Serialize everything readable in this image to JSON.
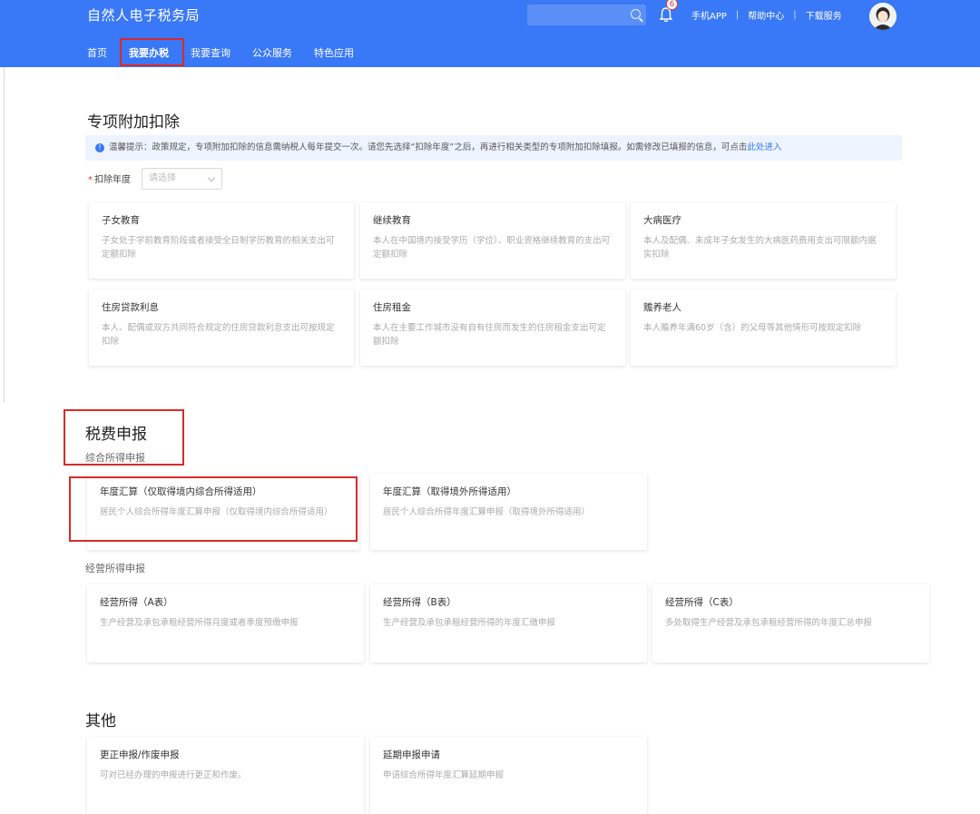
{
  "header": {
    "app_title": "自然人电子税务局",
    "badge_count": "6",
    "links": [
      "手机APP",
      "帮助中心",
      "下载服务"
    ],
    "nav": [
      "首页",
      "我要办税",
      "我要查询",
      "公众服务",
      "特色应用"
    ]
  },
  "deduction": {
    "title": "专项附加扣除",
    "tip_text": "温馨提示：政策规定，专项附加扣除的信息需纳税人每年提交一次。请您先选择“扣除年度”之后，再进行相关类型的专项附加扣除填报。如需修改已填报的信息，可点击",
    "tip_link": "此处进入",
    "year_label": "扣除年度",
    "year_placeholder": "请选择",
    "cards": [
      {
        "title": "子女教育",
        "desc": "子女处于学前教育阶段或者接受全日制学历教育的相关支出可定额扣除"
      },
      {
        "title": "继续教育",
        "desc": "本人在中国境内接受学历（学位）、职业资格继续教育的支出可定额扣除"
      },
      {
        "title": "大病医疗",
        "desc": "本人及配偶、未成年子女发生的大病医药费用支出可限额内据实扣除"
      },
      {
        "title": "住房贷款利息",
        "desc": "本人、配偶或双方共同符合规定的住房贷款利息支出可按规定扣除"
      },
      {
        "title": "住房租金",
        "desc": "本人在主要工作城市没有自有住房而发生的住房租金支出可定额扣除"
      },
      {
        "title": "赡养老人",
        "desc": "本人赡养年满60岁（含）的父母等其他情形可按规定扣除"
      }
    ]
  },
  "declaration": {
    "title": "税费申报",
    "comprehensive_subtitle": "综合所得申报",
    "comprehensive_cards": [
      {
        "title": "年度汇算（仅取得境内综合所得适用）",
        "desc": "居民个人综合所得年度汇算申报（仅取得境内综合所得适用）"
      },
      {
        "title": "年度汇算（取得境外所得适用）",
        "desc": "居民个人综合所得年度汇算申报（取得境外所得适用）"
      }
    ],
    "business_subtitle": "经营所得申报",
    "business_cards": [
      {
        "title": "经营所得（A表）",
        "desc": "生产经营及承包承租经营所得月度或者季度预缴申报"
      },
      {
        "title": "经营所得（B表）",
        "desc": "生产经营及承包承租经营所得的年度汇缴申报"
      },
      {
        "title": "经营所得（C表）",
        "desc": "多处取得生产经营及承包承租经营所得的年度汇总申报"
      }
    ]
  },
  "other": {
    "title": "其他",
    "cards": [
      {
        "title": "更正申报/作废申报",
        "desc": "可对已经办理的申报进行更正和作废。"
      },
      {
        "title": "延期申报申请",
        "desc": "申请综合所得年度汇算延期申报"
      }
    ]
  },
  "colors": {
    "header_bg": "#3978f6",
    "highlight": "#d62b2b"
  }
}
